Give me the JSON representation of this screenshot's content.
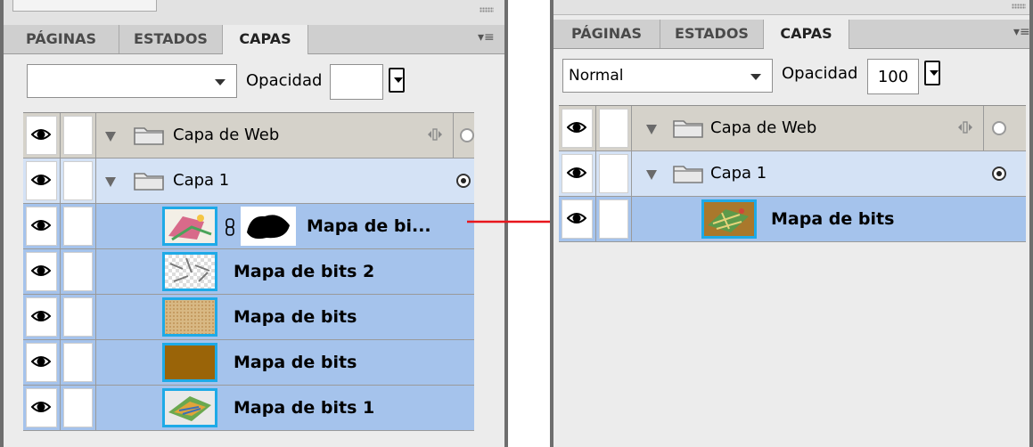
{
  "colors": {
    "selected_row": "#a5c3ec",
    "layer_row": "#d4e2f5",
    "web_layer_row": "#d5d2ca",
    "thumb_border": "#1eaae7",
    "arrow": "#e8161c"
  },
  "left": {
    "tabs": [
      "PÁGINAS",
      "ESTADOS",
      "CAPAS"
    ],
    "active_tab": "CAPAS",
    "blend_mode": "",
    "opacity_label": "Opacidad",
    "opacity_value": "",
    "rows": {
      "web_layer": "Capa de Web",
      "layer1": "Capa 1",
      "bitmap_masked": "Mapa de bi...",
      "bitmap2": "Mapa de bits 2",
      "bitmap_a": "Mapa de bits",
      "bitmap_b": "Mapa de bits",
      "bitmap1": "Mapa de bits 1"
    }
  },
  "right": {
    "tabs": [
      "PÁGINAS",
      "ESTADOS",
      "CAPAS"
    ],
    "active_tab": "CAPAS",
    "blend_mode": "Normal",
    "opacity_label": "Opacidad",
    "opacity_value": "100",
    "rows": {
      "web_layer": "Capa de Web",
      "layer1": "Capa 1",
      "bitmap": "Mapa de bits"
    }
  },
  "icons": {
    "eye": "eye-icon",
    "folder": "folder-icon",
    "menu": "panel-menu-icon",
    "expand": "triangle-down-icon",
    "chain": "link-chain-icon",
    "sublayer_toggle": "sublayer-share-icon",
    "arrow": "right-arrow-icon"
  }
}
